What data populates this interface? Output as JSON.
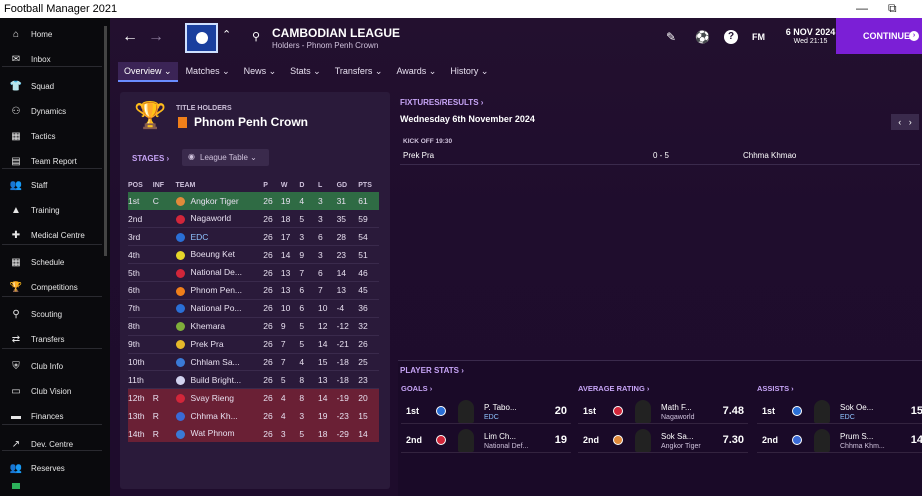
{
  "window": {
    "title": "Football Manager 2021",
    "minimize": "—",
    "restore": "⧉"
  },
  "sidebar": {
    "items": [
      {
        "label": "Home",
        "icon": "home-icon",
        "glyph": "⌂"
      },
      {
        "label": "Inbox",
        "icon": "inbox-icon",
        "glyph": "✉"
      },
      {
        "label": "Squad",
        "icon": "squad-icon",
        "glyph": "👕"
      },
      {
        "label": "Dynamics",
        "icon": "dynamics-icon",
        "glyph": "⚇"
      },
      {
        "label": "Tactics",
        "icon": "tactics-icon",
        "glyph": "▦"
      },
      {
        "label": "Team Report",
        "icon": "team-report-icon",
        "glyph": "▤"
      },
      {
        "label": "Staff",
        "icon": "staff-icon",
        "glyph": "👥"
      },
      {
        "label": "Training",
        "icon": "training-icon",
        "glyph": "▲"
      },
      {
        "label": "Medical Centre",
        "icon": "medical-icon",
        "glyph": "✚"
      },
      {
        "label": "Schedule",
        "icon": "schedule-icon",
        "glyph": "▦"
      },
      {
        "label": "Competitions",
        "icon": "trophy-icon",
        "glyph": "🏆"
      },
      {
        "label": "Scouting",
        "icon": "scouting-icon",
        "glyph": "⚲"
      },
      {
        "label": "Transfers",
        "icon": "transfers-icon",
        "glyph": "⇄"
      },
      {
        "label": "Club Info",
        "icon": "club-info-icon",
        "glyph": "⛨"
      },
      {
        "label": "Club Vision",
        "icon": "club-vision-icon",
        "glyph": "▭"
      },
      {
        "label": "Finances",
        "icon": "finances-icon",
        "glyph": "▬"
      },
      {
        "label": "Dev. Centre",
        "icon": "dev-centre-icon",
        "glyph": "↗"
      },
      {
        "label": "Reserves",
        "icon": "reserves-icon",
        "glyph": "👥"
      }
    ]
  },
  "header": {
    "back": "←",
    "forward": "→",
    "title": "CAMBODIAN LEAGUE",
    "subtitle": "Holders - Phnom Penh Crown",
    "fm": "FM",
    "date": "6 NOV 2024",
    "time": "Wed 21:15",
    "continue": "CONTINUE",
    "continue_icon": "›",
    "edit": "✎",
    "help": "?",
    "search": "⚲",
    "crest_switch": "⌃"
  },
  "tabs": [
    {
      "label": "Overview ⌄"
    },
    {
      "label": "Matches ⌄"
    },
    {
      "label": "News ⌄"
    },
    {
      "label": "Stats ⌄"
    },
    {
      "label": "Transfers ⌄"
    },
    {
      "label": "Awards ⌄"
    },
    {
      "label": "History ⌄"
    }
  ],
  "title_holders": {
    "label": "TITLE HOLDERS",
    "team": "Phnom Penh Crown"
  },
  "stages": {
    "label": "STAGES ›",
    "select": "League Table ⌄"
  },
  "league": {
    "headers": [
      "POS",
      "INF",
      "TEAM",
      "P",
      "W",
      "D",
      "L",
      "GD",
      "PTS"
    ],
    "rows": [
      {
        "pos": "1st",
        "inf": "C",
        "team": "Angkor Tiger",
        "p": "26",
        "w": "19",
        "d": "4",
        "l": "3",
        "gd": "31",
        "pts": "61",
        "color": "#e08a3a",
        "zone": "champ"
      },
      {
        "pos": "2nd",
        "inf": "",
        "team": "Nagaworld",
        "p": "26",
        "w": "18",
        "d": "5",
        "l": "3",
        "gd": "35",
        "pts": "59",
        "color": "#d2263a",
        "zone": "mid"
      },
      {
        "pos": "3rd",
        "inf": "",
        "team": "EDC",
        "p": "26",
        "w": "17",
        "d": "3",
        "l": "6",
        "gd": "28",
        "pts": "54",
        "color": "#2a6fd6",
        "zone": "mid",
        "link": true
      },
      {
        "pos": "4th",
        "inf": "",
        "team": "Boeung Ket",
        "p": "26",
        "w": "14",
        "d": "9",
        "l": "3",
        "gd": "23",
        "pts": "51",
        "color": "#e6d62a",
        "zone": "mid"
      },
      {
        "pos": "5th",
        "inf": "",
        "team": "National De...",
        "p": "26",
        "w": "13",
        "d": "7",
        "l": "6",
        "gd": "14",
        "pts": "46",
        "color": "#d2263a",
        "zone": "mid"
      },
      {
        "pos": "6th",
        "inf": "",
        "team": "Phnom Pen...",
        "p": "26",
        "w": "13",
        "d": "6",
        "l": "7",
        "gd": "13",
        "pts": "45",
        "color": "#f07f1a",
        "zone": "mid"
      },
      {
        "pos": "7th",
        "inf": "",
        "team": "National Po...",
        "p": "26",
        "w": "10",
        "d": "6",
        "l": "10",
        "gd": "-4",
        "pts": "36",
        "color": "#2a6fd6",
        "zone": "mid"
      },
      {
        "pos": "8th",
        "inf": "",
        "team": "Khemara",
        "p": "26",
        "w": "9",
        "d": "5",
        "l": "12",
        "gd": "-12",
        "pts": "32",
        "color": "#7fae3a",
        "zone": "mid"
      },
      {
        "pos": "9th",
        "inf": "",
        "team": "Prek Pra",
        "p": "26",
        "w": "7",
        "d": "5",
        "l": "14",
        "gd": "-21",
        "pts": "26",
        "color": "#e6b92a",
        "zone": "mid"
      },
      {
        "pos": "10th",
        "inf": "",
        "team": "Chhlam Sa...",
        "p": "26",
        "w": "7",
        "d": "4",
        "l": "15",
        "gd": "-18",
        "pts": "25",
        "color": "#3a7ad6",
        "zone": "mid"
      },
      {
        "pos": "11th",
        "inf": "",
        "team": "Build Bright...",
        "p": "26",
        "w": "5",
        "d": "8",
        "l": "13",
        "gd": "-18",
        "pts": "23",
        "color": "#d2d2ee",
        "zone": "mid"
      },
      {
        "pos": "12th",
        "inf": "R",
        "team": "Svay Rieng",
        "p": "26",
        "w": "4",
        "d": "8",
        "l": "14",
        "gd": "-19",
        "pts": "20",
        "color": "#d2263a",
        "zone": "rel"
      },
      {
        "pos": "13th",
        "inf": "R",
        "team": "Chhma Kh...",
        "p": "26",
        "w": "4",
        "d": "3",
        "l": "19",
        "gd": "-23",
        "pts": "15",
        "color": "#3a6ad6",
        "zone": "rel"
      },
      {
        "pos": "14th",
        "inf": "R",
        "team": "Wat Phnom",
        "p": "26",
        "w": "3",
        "d": "5",
        "l": "18",
        "gd": "-29",
        "pts": "14",
        "color": "#3a7ad6",
        "zone": "rel"
      }
    ]
  },
  "fixtures": {
    "label": "FIXTURES/RESULTS ›",
    "date": "Wednesday 6th November 2024",
    "kickoff": "KICK OFF 19:30",
    "home": "Prek Pra",
    "score": "0 - 5",
    "away": "Chhma Khmao",
    "prev": "‹",
    "next": "›"
  },
  "player_stats": {
    "label": "PLAYER STATS ›",
    "cols": [
      {
        "title": "GOALS ›",
        "rows": [
          {
            "rank": "1st",
            "name": "P. Tabo...",
            "club": "EDC",
            "value": "20",
            "color": "#2a6fd6",
            "link": true
          },
          {
            "rank": "2nd",
            "name": "Lim Ch...",
            "club": "National Def...",
            "value": "19",
            "color": "#d2263a"
          }
        ]
      },
      {
        "title": "AVERAGE RATING ›",
        "rows": [
          {
            "rank": "1st",
            "name": "Math F...",
            "club": "Nagaworld",
            "value": "7.48",
            "color": "#d2263a"
          },
          {
            "rank": "2nd",
            "name": "Sok Sa...",
            "club": "Angkor Tiger",
            "value": "7.30",
            "color": "#e08a3a"
          }
        ]
      },
      {
        "title": "ASSISTS ›",
        "rows": [
          {
            "rank": "1st",
            "name": "Sok Oe...",
            "club": "EDC",
            "value": "15",
            "color": "#2a6fd6",
            "link": true
          },
          {
            "rank": "2nd",
            "name": "Prum S...",
            "club": "Chhma Khm...",
            "value": "14",
            "color": "#3a6ad6"
          }
        ]
      }
    ]
  }
}
